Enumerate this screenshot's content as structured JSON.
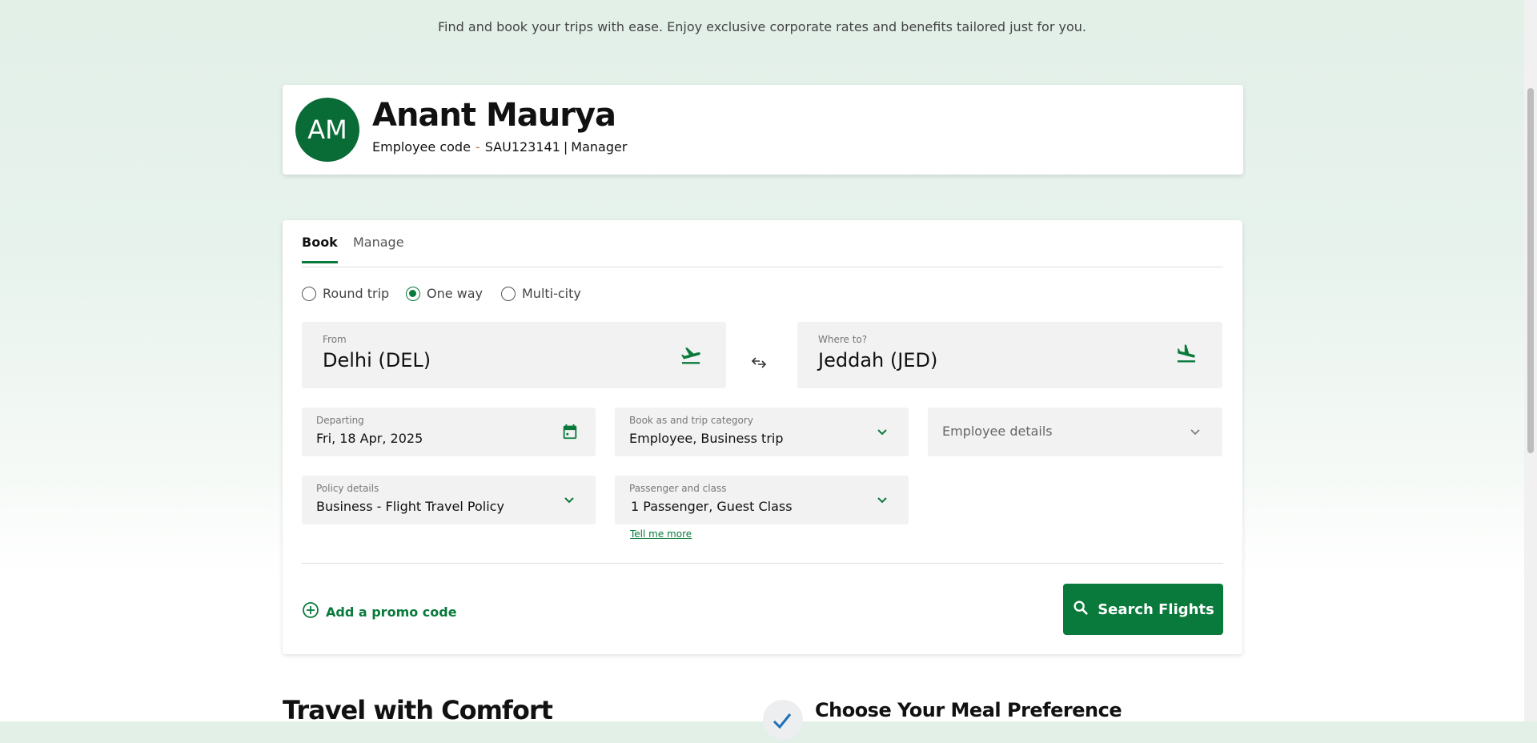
{
  "intro_text": "Find and book your trips with ease. Enjoy exclusive corporate rates and benefits tailored just for you.",
  "profile": {
    "initials": "AM",
    "name": "Anant Maurya",
    "employee_code_label": "Employee code",
    "employee_code": "SAU123141",
    "role": "Manager"
  },
  "tabs": [
    {
      "label": "Book",
      "active": true
    },
    {
      "label": "Manage",
      "active": false
    }
  ],
  "trip_types": [
    {
      "label": "Round trip",
      "selected": false
    },
    {
      "label": "One way",
      "selected": true
    },
    {
      "label": "Multi-city",
      "selected": false
    }
  ],
  "from": {
    "label": "From",
    "value": "Delhi (DEL)",
    "icon": "flight-takeoff-icon"
  },
  "to": {
    "label": "Where to?",
    "value": "Jeddah (JED)",
    "icon": "flight-land-icon"
  },
  "departing": {
    "label": "Departing",
    "value": "Fri, 18 Apr, 2025",
    "icon": "calendar-icon"
  },
  "book_as": {
    "label": "Book as and trip category",
    "value": "Employee, Business trip"
  },
  "employee_details": {
    "placeholder": "Employee details"
  },
  "policy": {
    "label": "Policy details",
    "value": "Business - Flight Travel Policy"
  },
  "passenger": {
    "label": "Passenger and class",
    "value": "1 Passenger, Guest Class",
    "link": "Tell me more"
  },
  "promo_label": "Add a promo code",
  "search_label": "Search Flights",
  "sections": {
    "comfort_title": "Travel with Comfort",
    "meal_title": "Choose Your Meal Preference"
  },
  "colors": {
    "brand_green": "#0a7a3c",
    "avatar_green": "#096b35",
    "field_bg": "#f2f2f2"
  }
}
